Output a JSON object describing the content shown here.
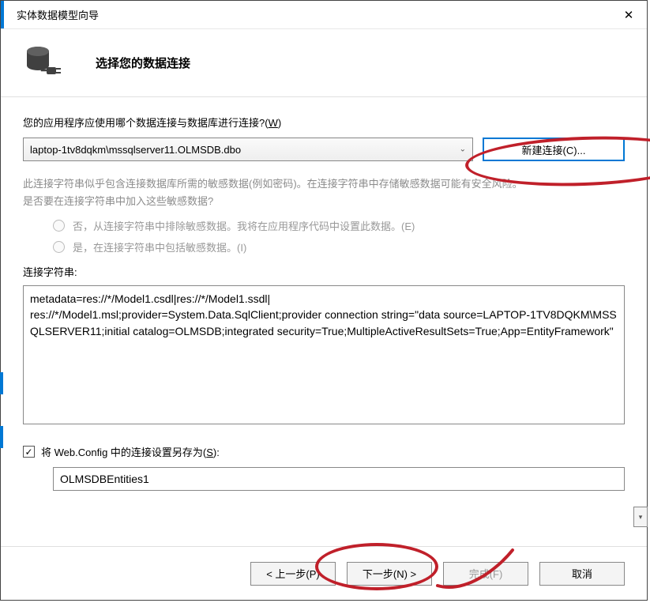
{
  "window": {
    "title": "实体数据模型向导"
  },
  "header": {
    "heading": "选择您的数据连接"
  },
  "main": {
    "prompt_prefix": "您的应用程序应使用哪个数据连接与数据库进行连接?(",
    "prompt_key": "W",
    "prompt_suffix": ")",
    "connection_selected": "laptop-1tv8dqkm\\mssqlserver11.OLMSDB.dbo",
    "new_connection_label": "新建连接(C)...",
    "warning_line1": "此连接字符串似乎包含连接数据库所需的敏感数据(例如密码)。在连接字符串中存储敏感数据可能有安全风险。",
    "warning_line2": "是否要在连接字符串中加入这些敏感数据?",
    "radio_exclude": "否，从连接字符串中排除敏感数据。我将在应用程序代码中设置此数据。(E)",
    "radio_include": "是，在连接字符串中包括敏感数据。(I)",
    "cs_label": "连接字符串:",
    "cs_value": "metadata=res://*/Model1.csdl|res://*/Model1.ssdl|\nres://*/Model1.msl;provider=System.Data.SqlClient;provider connection string=\"data source=LAPTOP-1TV8DQKM\\MSSQLSERVER11;initial catalog=OLMSDB;integrated security=True;MultipleActiveResultSets=True;App=EntityFramework\"",
    "save_checkbox_checked": true,
    "save_label_prefix": "将 Web.Config 中的连接设置另存为(",
    "save_label_key": "S",
    "save_label_suffix": "):",
    "save_name_value": "OLMSDBEntities1"
  },
  "footer": {
    "back": "< 上一步(P)",
    "next": "下一步(N) >",
    "finish": "完成(F)",
    "cancel": "取消"
  },
  "annotation": {
    "color": "#c0202a"
  }
}
